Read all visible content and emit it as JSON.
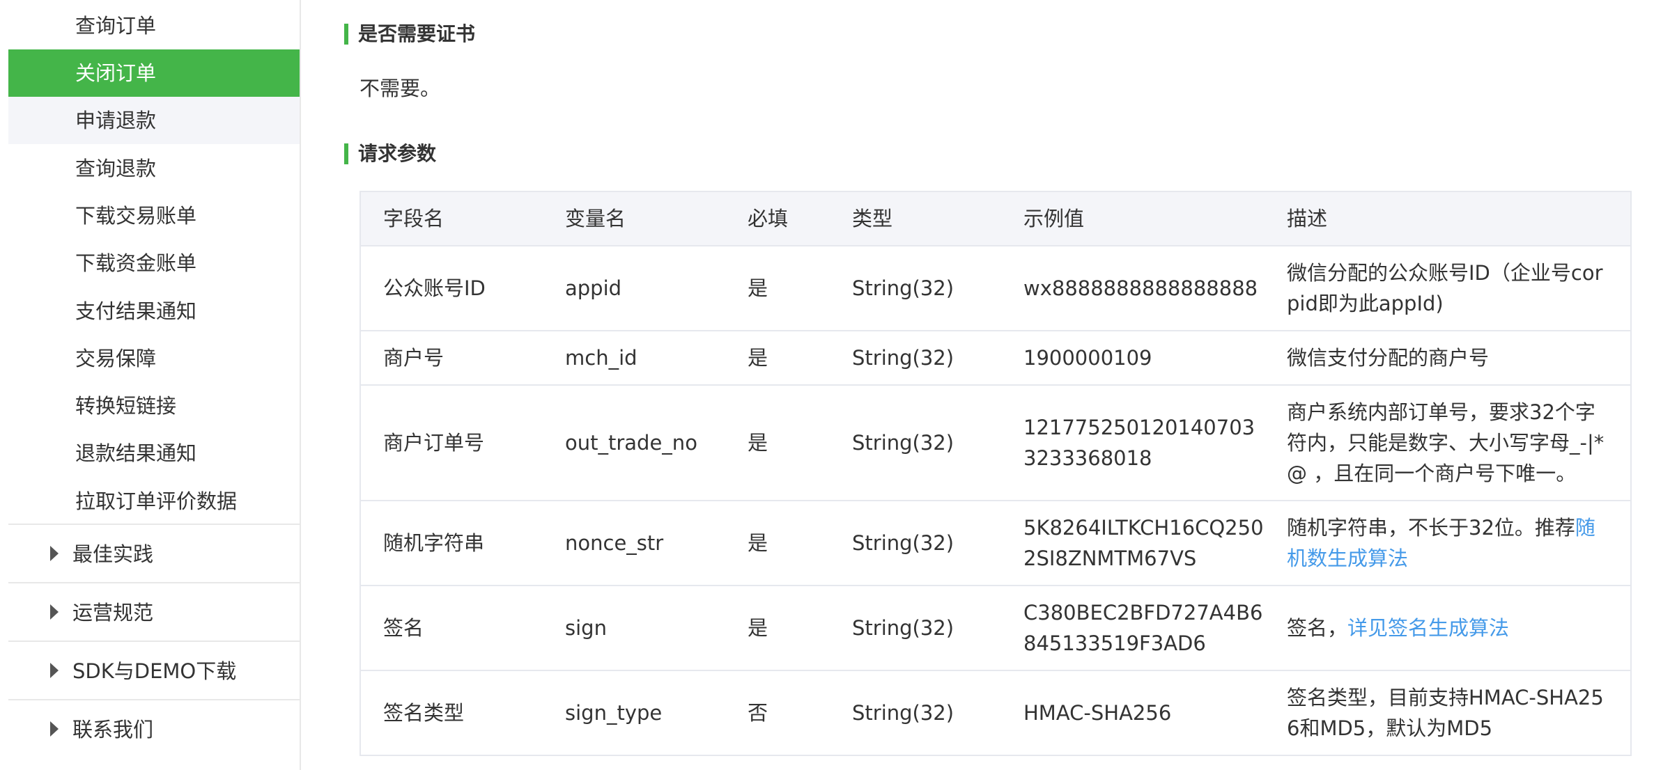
{
  "sidebar": {
    "items": [
      {
        "label": "查询订单"
      },
      {
        "label": "关闭订单"
      },
      {
        "label": "申请退款"
      },
      {
        "label": "查询退款"
      },
      {
        "label": "下载交易账单"
      },
      {
        "label": "下载资金账单"
      },
      {
        "label": "支付结果通知"
      },
      {
        "label": "交易保障"
      },
      {
        "label": "转换短链接"
      },
      {
        "label": "退款结果通知"
      },
      {
        "label": "拉取订单评价数据"
      }
    ],
    "groups": [
      {
        "label": "最佳实践"
      },
      {
        "label": "运营规范"
      },
      {
        "label": "SDK与DEMO下载"
      },
      {
        "label": "联系我们"
      }
    ]
  },
  "main": {
    "cert_heading": "是否需要证书",
    "cert_text": "不需要。",
    "params_heading": "请求参数",
    "table": {
      "headers": [
        "字段名",
        "变量名",
        "必填",
        "类型",
        "示例值",
        "描述"
      ],
      "rows": [
        {
          "field": "公众账号ID",
          "var": "appid",
          "required": "是",
          "type": "String(32)",
          "example": "wx8888888888888888",
          "desc": "微信分配的公众账号ID（企业号corpid即为此appId)",
          "desc_link": ""
        },
        {
          "field": "商户号",
          "var": "mch_id",
          "required": "是",
          "type": "String(32)",
          "example": "1900000109",
          "desc": "微信支付分配的商户号",
          "desc_link": ""
        },
        {
          "field": "商户订单号",
          "var": "out_trade_no",
          "required": "是",
          "type": "String(32)",
          "example": "1217752501201407033233368018",
          "desc": "商户系统内部订单号，要求32个字符内，只能是数字、大小写字母_-|*@ ，且在同一个商户号下唯一。",
          "desc_link": ""
        },
        {
          "field": "随机字符串",
          "var": "nonce_str",
          "required": "是",
          "type": "String(32)",
          "example": "5K8264ILTKCH16CQ2502SI8ZNMTM67VS",
          "desc": "随机字符串，不长于32位。推荐",
          "desc_link": "随机数生成算法"
        },
        {
          "field": "签名",
          "var": "sign",
          "required": "是",
          "type": "String(32)",
          "example": "C380BEC2BFD727A4B6845133519F3AD6",
          "desc": "签名，",
          "desc_link": "详见签名生成算法"
        },
        {
          "field": "签名类型",
          "var": "sign_type",
          "required": "否",
          "type": "String(32)",
          "example": "HMAC-SHA256",
          "desc": "签名类型，目前支持HMAC-SHA256和MD5，默认为MD5",
          "desc_link": ""
        }
      ]
    }
  },
  "colors": {
    "accent": "#44b549",
    "link": "#459ae9",
    "header_bg": "#f4f5f9",
    "border": "#e6e8ee"
  }
}
